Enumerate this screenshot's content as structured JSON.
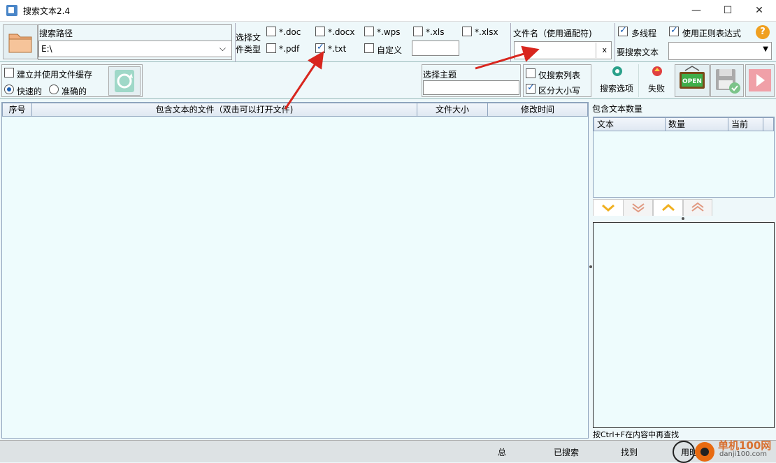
{
  "window": {
    "title": "搜索文本2.4",
    "minimize": "—",
    "maximize": "☐",
    "close": "✕"
  },
  "search_path": {
    "label": "搜索路径",
    "value": "E:\\"
  },
  "file_types": {
    "label_line1": "选择文",
    "label_line2": "件类型",
    "options": [
      {
        "label": "*.doc",
        "checked": false
      },
      {
        "label": "*.docx",
        "checked": false
      },
      {
        "label": "*.wps",
        "checked": false
      },
      {
        "label": "*.xls",
        "checked": false
      },
      {
        "label": "*.xlsx",
        "checked": false
      },
      {
        "label": "*.pdf",
        "checked": false
      },
      {
        "label": "*.txt",
        "checked": true
      },
      {
        "label": "自定义",
        "checked": false
      }
    ]
  },
  "filename": {
    "label": "文件名（使用通配符)",
    "clear": "x"
  },
  "options": {
    "multithread": "多线程",
    "regex": "使用正则表达式",
    "search_text_label": "要搜索文本",
    "cache": "建立并使用文件缓存",
    "fast": "快速的",
    "accurate": "准确的",
    "theme_label": "选择主题",
    "search_list_only": "仅搜索列表",
    "case_sensitive": "区分大小写"
  },
  "toolbar": {
    "search_options": "搜索选项",
    "fail": "失败",
    "open_badge": "OPEN"
  },
  "results_table": {
    "columns": [
      "序号",
      "包含文本的文件（双击可以打开文件)",
      "文件大小",
      "修改时间"
    ]
  },
  "count_panel": {
    "title": "包含文本数量",
    "columns": [
      "文本",
      "数量",
      "当前"
    ]
  },
  "find_hint": "按Ctrl+F在内容中再查找",
  "status": {
    "total": "总",
    "searched": "已搜索",
    "found": "找到",
    "time": "用时"
  },
  "watermark": {
    "brand": "单机100网",
    "url": "danji100.com"
  },
  "colors": {
    "accent_red": "#d8261e",
    "check_blue": "#1a5fb4"
  }
}
